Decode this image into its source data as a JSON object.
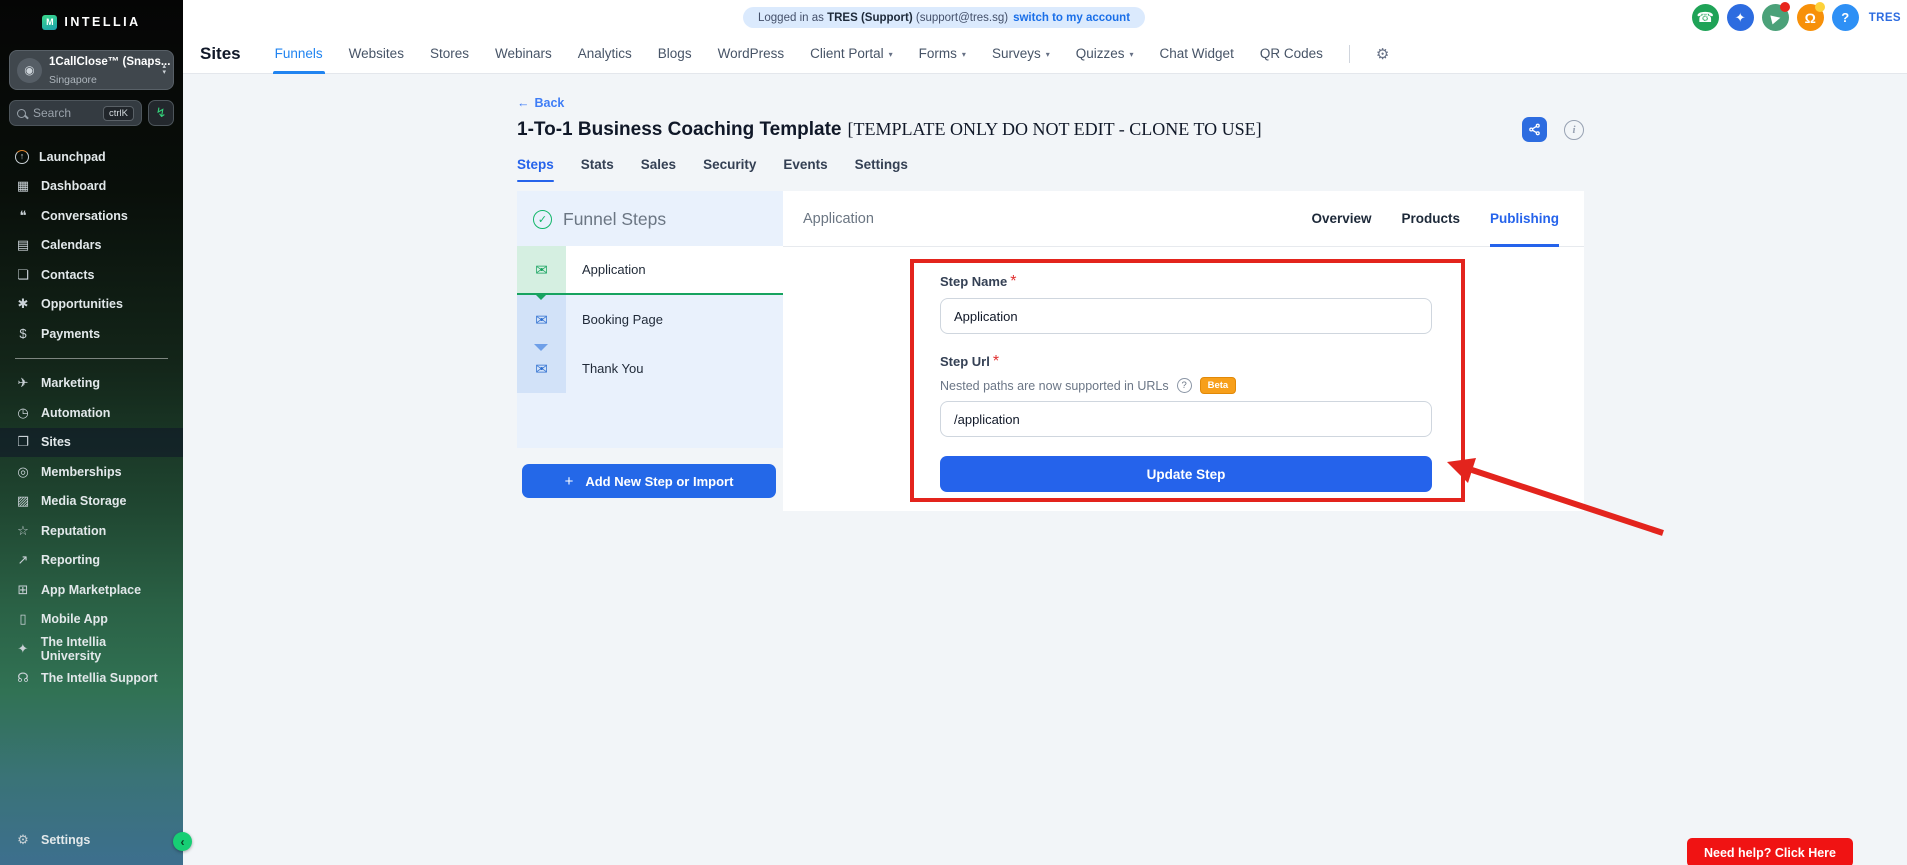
{
  "sidebar": {
    "logo": "INTELLIA",
    "logo_mark": "M",
    "account": {
      "name": "1CallClose™ (Snaps...",
      "location": "Singapore"
    },
    "search": {
      "placeholder": "Search",
      "shortcut": "ctrlK"
    },
    "items": [
      {
        "label": "Launchpad",
        "icon": "launchpad-icon",
        "glyph": "↑"
      },
      {
        "label": "Dashboard",
        "icon": "dashboard-icon",
        "glyph": "▦"
      },
      {
        "label": "Conversations",
        "icon": "conversations-icon",
        "glyph": "❝"
      },
      {
        "label": "Calendars",
        "icon": "calendars-icon",
        "glyph": "▤"
      },
      {
        "label": "Contacts",
        "icon": "contacts-icon",
        "glyph": "❏"
      },
      {
        "label": "Opportunities",
        "icon": "opportunities-icon",
        "glyph": "✱"
      },
      {
        "label": "Payments",
        "icon": "payments-icon",
        "glyph": "$"
      },
      {
        "divider": true
      },
      {
        "label": "Marketing",
        "icon": "marketing-icon",
        "glyph": "✈"
      },
      {
        "label": "Automation",
        "icon": "automation-icon",
        "glyph": "◷"
      },
      {
        "label": "Sites",
        "icon": "sites-icon",
        "glyph": "❐",
        "active": true
      },
      {
        "label": "Memberships",
        "icon": "memberships-icon",
        "glyph": "◎"
      },
      {
        "label": "Media Storage",
        "icon": "media-storage-icon",
        "glyph": "▨"
      },
      {
        "label": "Reputation",
        "icon": "reputation-icon",
        "glyph": "☆"
      },
      {
        "label": "Reporting",
        "icon": "reporting-icon",
        "glyph": "↗"
      },
      {
        "label": "App Marketplace",
        "icon": "app-marketplace-icon",
        "glyph": "⊞"
      },
      {
        "label": "Mobile App",
        "icon": "mobile-app-icon",
        "glyph": "▯"
      },
      {
        "label": "The Intellia University",
        "icon": "graduation-cap-icon",
        "glyph": "✦"
      },
      {
        "label": "The Intellia Support",
        "icon": "headset-icon",
        "glyph": "☊"
      }
    ],
    "settings_label": "Settings"
  },
  "topbar": {
    "login_prefix": "Logged in as",
    "login_user": "TRES (Support)",
    "login_email": "(support@tres.sg)",
    "switch_link": "switch to my account",
    "user_initials": "TRES"
  },
  "nav": {
    "section": "Sites",
    "items": [
      {
        "label": "Funnels",
        "active": true
      },
      {
        "label": "Websites"
      },
      {
        "label": "Stores"
      },
      {
        "label": "Webinars"
      },
      {
        "label": "Analytics"
      },
      {
        "label": "Blogs"
      },
      {
        "label": "WordPress"
      },
      {
        "label": "Client Portal",
        "caret": true
      },
      {
        "label": "Forms",
        "caret": true
      },
      {
        "label": "Surveys",
        "caret": true
      },
      {
        "label": "Quizzes",
        "caret": true
      },
      {
        "label": "Chat Widget"
      },
      {
        "label": "QR Codes"
      }
    ]
  },
  "page": {
    "back_label": "Back",
    "title_main": "1-To-1 Business Coaching Template",
    "title_note": "[TEMPLATE ONLY DO NOT EDIT - CLONE TO USE]",
    "tabs": [
      {
        "label": "Steps",
        "active": true
      },
      {
        "label": "Stats"
      },
      {
        "label": "Sales"
      },
      {
        "label": "Security"
      },
      {
        "label": "Events"
      },
      {
        "label": "Settings"
      }
    ]
  },
  "funnel": {
    "header": "Funnel Steps",
    "steps": [
      {
        "label": "Application",
        "active": true
      },
      {
        "label": "Booking Page"
      },
      {
        "label": "Thank You"
      }
    ],
    "add_button": "Add New Step or Import"
  },
  "editor": {
    "header": "Application",
    "tabs": [
      {
        "label": "Overview"
      },
      {
        "label": "Products"
      },
      {
        "label": "Publishing",
        "active": true
      }
    ],
    "step_name_label": "Step Name",
    "step_name_value": "Application",
    "step_url_label": "Step Url",
    "url_helper": "Nested paths are now supported in URLs",
    "beta_badge": "Beta",
    "step_url_value": "/application",
    "update_button": "Update Step"
  },
  "help_button": "Need help? Click Here",
  "colors": {
    "accent_blue": "#2563eb",
    "nav_active_blue": "#2184f0",
    "success_green": "#17a35f",
    "annotation_red": "#e3241d",
    "help_red": "#f01313",
    "beta_orange": "#f79f1a",
    "funnel_panel_blue": "#e9f1fc"
  }
}
